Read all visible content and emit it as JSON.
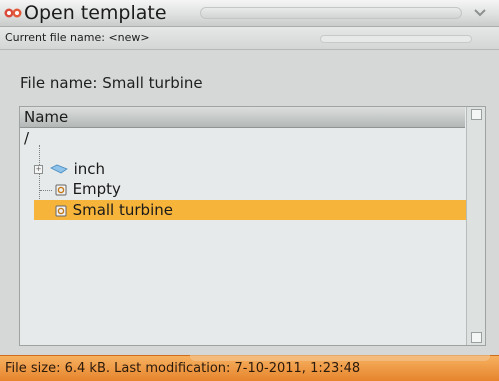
{
  "window": {
    "title": "Open template",
    "current_file_label": "Current file name: <new>"
  },
  "form": {
    "file_name_label": "File name: Small turbine"
  },
  "browser": {
    "column_header": "Name",
    "root": "/",
    "items": [
      {
        "label": "inch",
        "icon": "folder-icon",
        "expandable": true,
        "selected": false
      },
      {
        "label": "Empty",
        "icon": "template-file-icon",
        "expandable": false,
        "selected": false
      },
      {
        "label": "Small turbine",
        "icon": "template-file-icon",
        "expandable": false,
        "selected": true
      }
    ]
  },
  "status": {
    "text": "File size: 6.4 kB. Last modification:  7-10-2011, 1:23:48"
  },
  "colors": {
    "accent_selection": "#f6b43a",
    "status_bar": "#e6842d",
    "app_icon": "#d94a3a"
  }
}
